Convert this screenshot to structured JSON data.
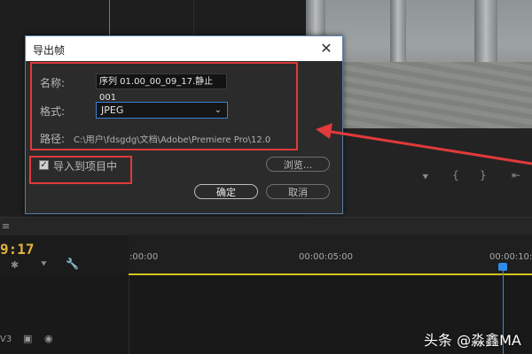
{
  "timeline": {
    "timecode": "9:17",
    "ruler_ticks": [
      ":00:00",
      "00:00:05:00",
      "00:00:10:0"
    ],
    "track_label": "V3",
    "hamburger": "≡"
  },
  "dialog": {
    "title": "导出帧",
    "close": "✕",
    "name_label": "名称:",
    "name_value": "序列 01.00_00_09_17.静止001",
    "format_label": "格式:",
    "format_value": "JPEG",
    "path_label": "路径:",
    "path_value": "C:\\用户\\fdsgdg\\文档\\Adobe\\Premiere Pro\\12.0",
    "import_checked": true,
    "import_label": "导入到项目中",
    "browse_button": "浏览...",
    "ok_button": "确定",
    "cancel_button": "取消"
  },
  "annotation": {
    "color": "#e03a3a"
  },
  "watermark": "头条 @淼鑫MA"
}
